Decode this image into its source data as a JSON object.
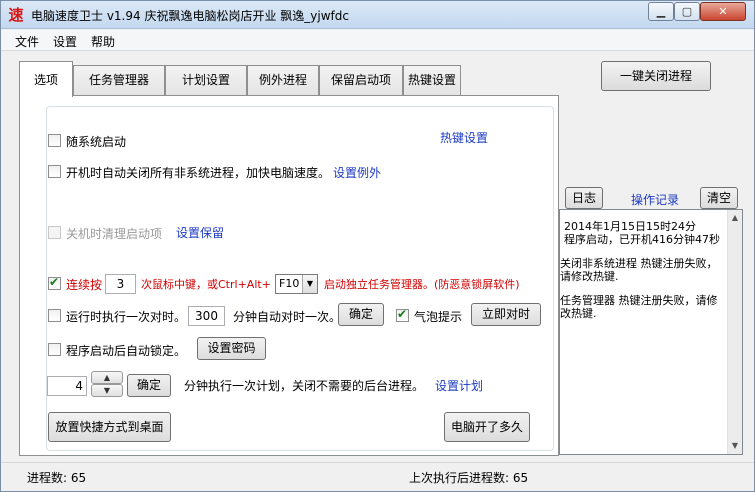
{
  "window": {
    "title": "电脑速度卫士 v1.94 庆祝飘逸电脑松岗店开业 飘逸_yjwfdc",
    "icon_glyph": "速",
    "min_glyph": "▁",
    "max_glyph": "▢",
    "close_glyph": "✕"
  },
  "menu": {
    "items": [
      "文件",
      "设置",
      "帮助"
    ]
  },
  "tabs": [
    "选项",
    "任务管理器",
    "计划设置",
    "例外进程",
    "保留启动项",
    "热键设置"
  ],
  "top_right_button": "一键关闭进程",
  "options": {
    "autostart_label": "随系统启动",
    "hotkey_link": "热键设置",
    "autoclose_label": "开机时自动关闭所有非系统进程，加快电脑速度。",
    "set_exceptions_link": "设置例外",
    "clean_startup_label": "关机时清理启动项",
    "set_keep_link": "设置保留",
    "hotkey_prefix": "连续按",
    "hotkey_count": "3",
    "hotkey_middle": "次鼠标中键，或Ctrl+Alt+",
    "hotkey_key": "F10",
    "hotkey_suffix": "启动独立任务管理器。(防恶意锁屏软件)",
    "timesync_label": "运行时执行一次对时。",
    "timesync_minutes": "300",
    "timesync_suffix": "分钟自动对时一次。",
    "confirm_label": "确定",
    "bubble_label": "气泡提示",
    "sync_now_label": "立即对时",
    "autolock_label": "程序启动后自动锁定。",
    "set_password_label": "设置密码",
    "plan_minutes": "4",
    "plan_confirm_label": "确定",
    "plan_text": "分钟执行一次计划，关闭不需要的后台进程。",
    "set_plan_link": "设置计划",
    "shortcut_button": "放置快捷方式到桌面",
    "uptime_button": "电脑开了多久",
    "spin_up_glyph": "▲",
    "spin_down_glyph": "▼",
    "select_arrow_glyph": "▼"
  },
  "log_panel": {
    "log_button": "日志",
    "records_link": "操作记录",
    "clear_button": "清空",
    "entries": [
      "2014年1月15日15时24分\n程序启动，已开机416分钟47秒",
      "关闭非系统进程 热键注册失败，请修改热键.",
      "任务管理器 热键注册失败，请修改热键."
    ],
    "scroll_up_glyph": "▲",
    "scroll_down_glyph": "▼"
  },
  "status": {
    "process_count": "进程数: 65",
    "last_run_count": "上次执行后进程数: 65"
  }
}
